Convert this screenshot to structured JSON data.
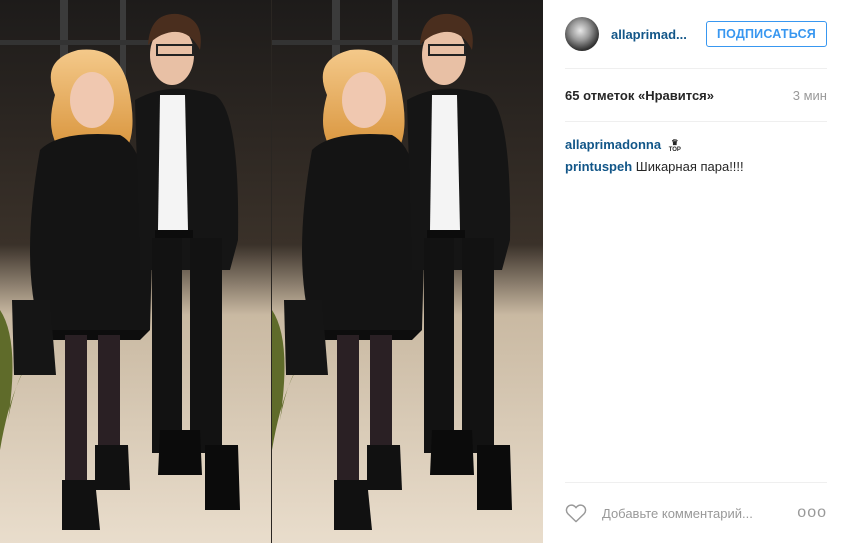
{
  "post": {
    "header": {
      "username": "allaprimad...",
      "follow_label": "ПОДПИСАТЬСЯ"
    },
    "stats": {
      "likes": "65 отметок «Нравится»",
      "time": "3 мин"
    },
    "comments": [
      {
        "user": "allaprimadonna",
        "badge": "TOP",
        "text": ""
      },
      {
        "user": "printuspeh",
        "text": "Шикарная пара!!!!"
      }
    ],
    "footer": {
      "comment_placeholder": "Добавьте комментарий...",
      "more_label": "ooo"
    }
  },
  "colors": {
    "username": "#125688",
    "follow_accent": "#3897f0",
    "secondary_text": "#999999",
    "divider": "#efefef"
  }
}
